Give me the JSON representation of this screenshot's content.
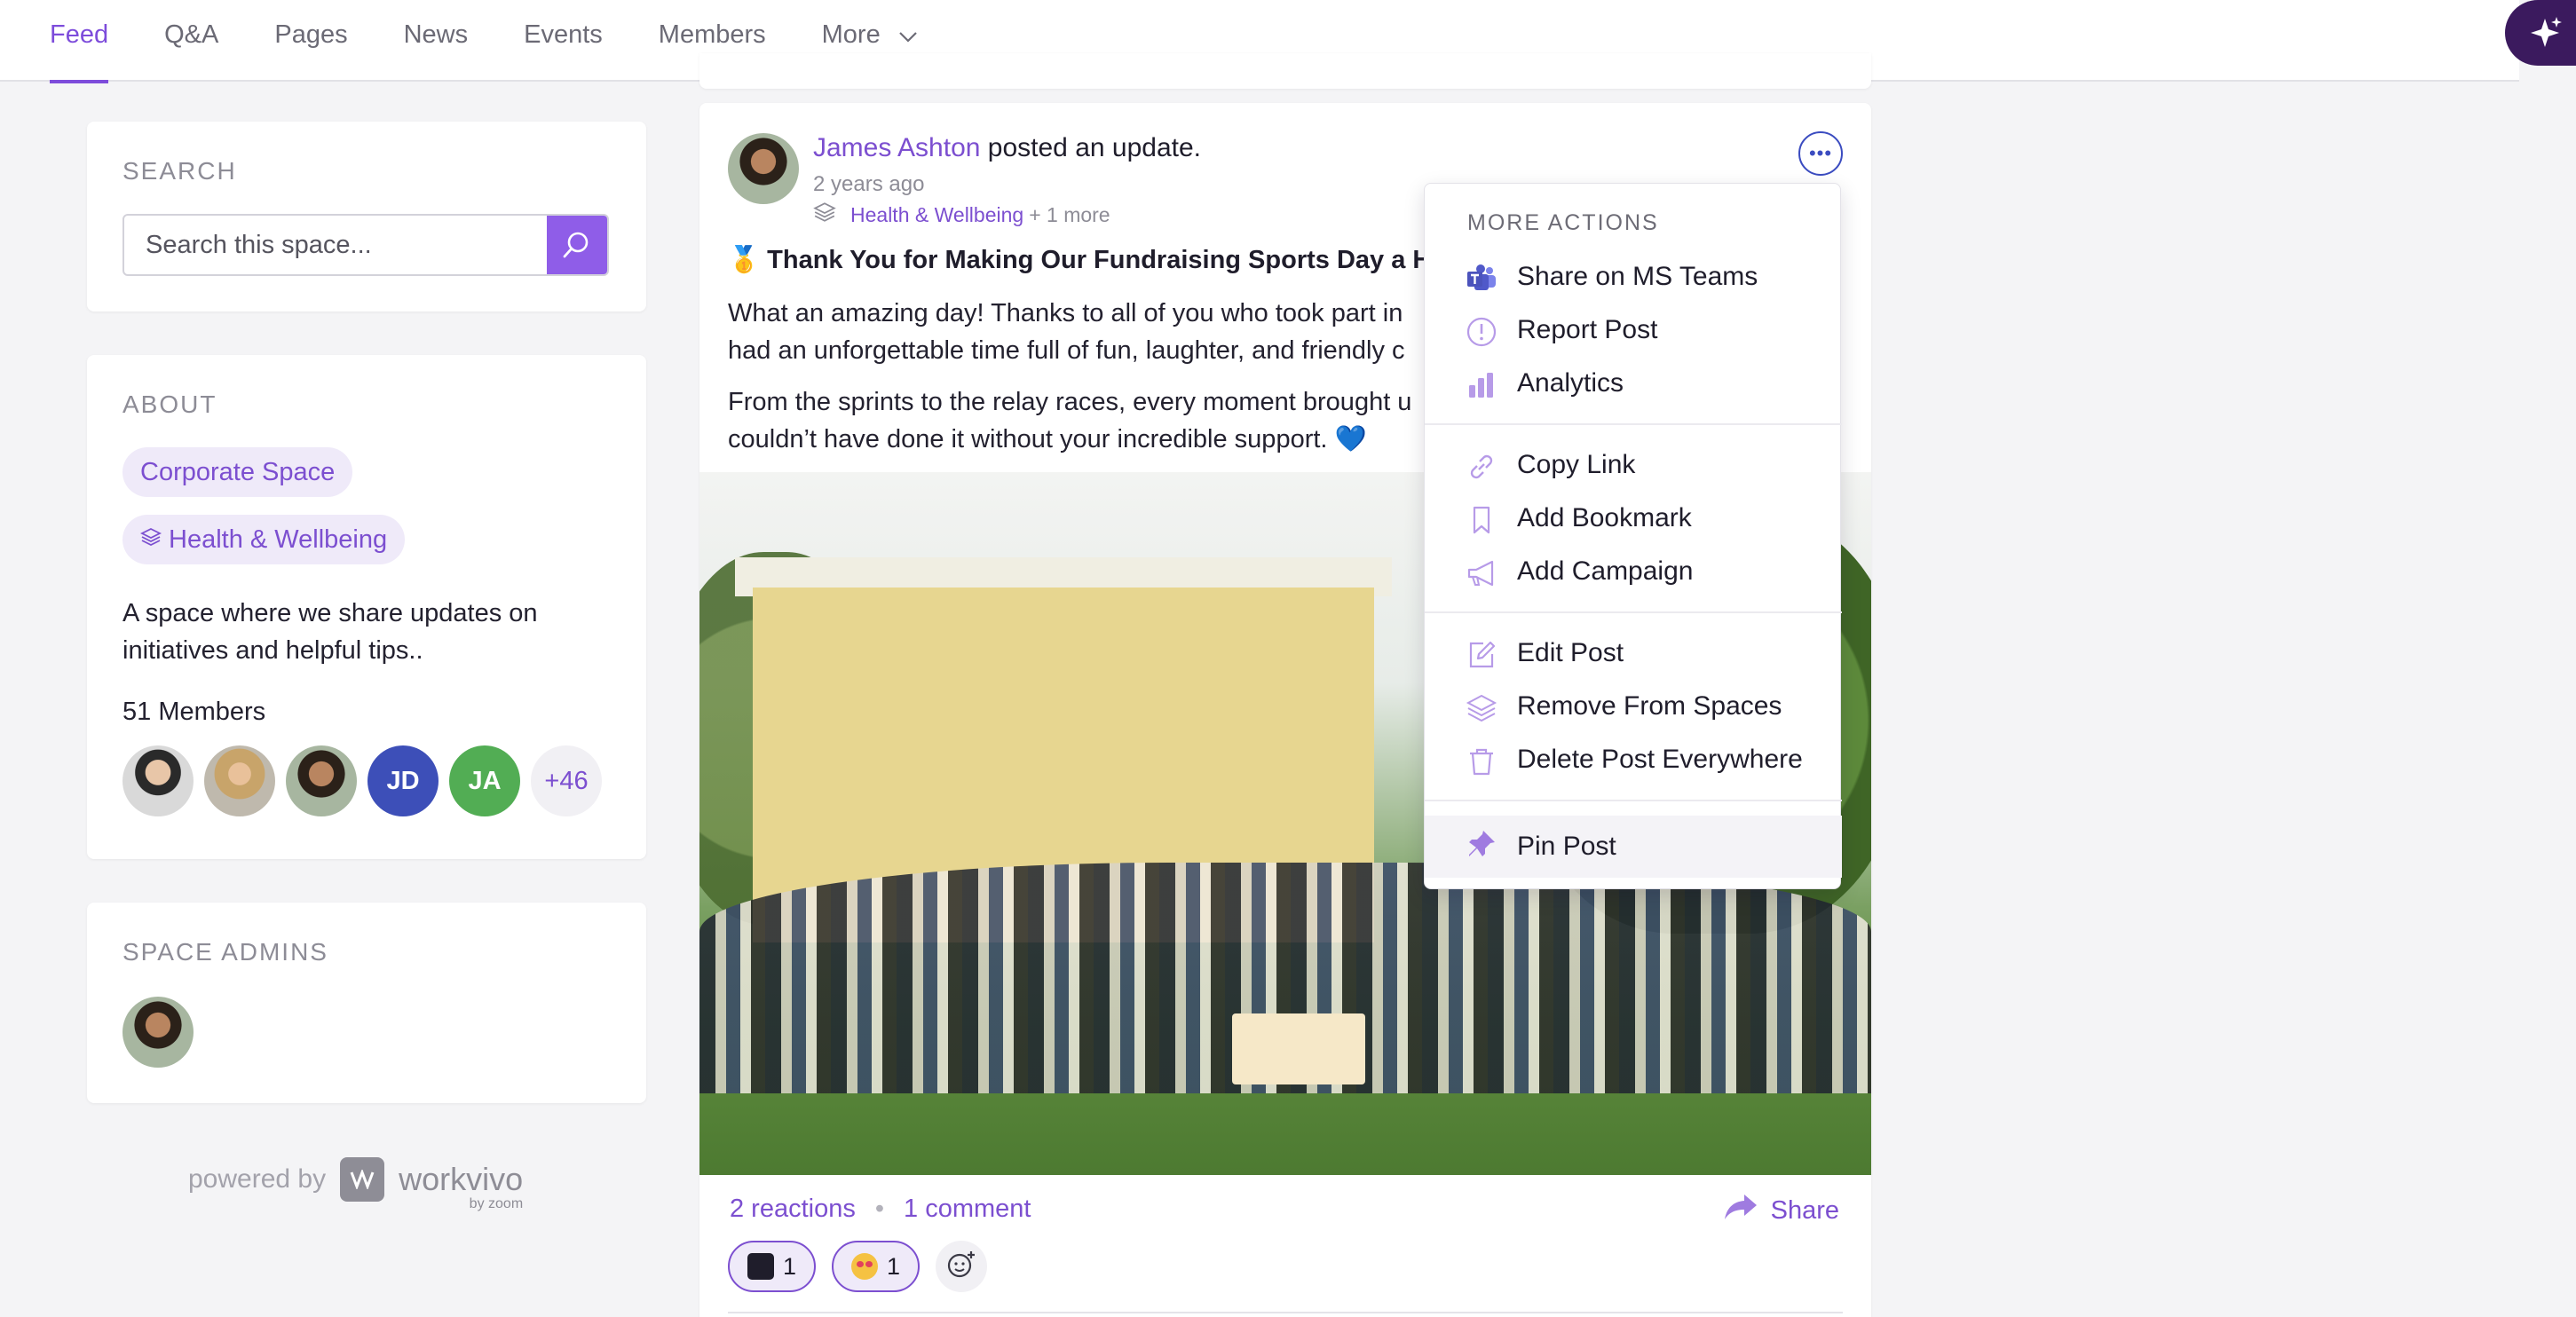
{
  "nav": {
    "tabs": [
      {
        "label": "Feed"
      },
      {
        "label": "Q&A"
      },
      {
        "label": "Pages"
      },
      {
        "label": "News"
      },
      {
        "label": "Events"
      },
      {
        "label": "Members"
      },
      {
        "label": "More"
      }
    ],
    "active_tab": "Feed"
  },
  "search": {
    "label": "SEARCH",
    "placeholder": "Search this space..."
  },
  "about": {
    "label": "ABOUT",
    "tags": [
      "Corporate Space",
      "Health & Wellbeing"
    ],
    "description": "A space where we share updates on initiatives and helpful tips..",
    "members_count": "51 Members",
    "member_initials": [
      "JD",
      "JA"
    ],
    "more_members": "+46"
  },
  "admins": {
    "label": "SPACE ADMINS"
  },
  "powered": {
    "prefix": "powered by",
    "brand": "workvivo",
    "sub": "by zoom"
  },
  "post": {
    "author": "James Ashton",
    "action": "posted an update.",
    "time": "2 years ago",
    "space": "Health & Wellbeing",
    "space_more": "+ 1 more",
    "title": "🥇 Thank You for Making Our Fundraising Sports Day a Hu",
    "body_1": "What an amazing day! Thanks to all of you who took part in",
    "body_1b": "had an unforgettable time full of fun, laughter, and friendly c",
    "body_2": "From the sprints to the relay races, every moment brought u",
    "body_2b": "couldn’t have done it without your incredible support. 💙",
    "reactions": "2 reactions",
    "comments": "1 comment",
    "share": "Share",
    "chip1_count": "1",
    "chip2_count": "1"
  },
  "menu": {
    "heading": "MORE ACTIONS",
    "items": [
      {
        "label": "Share on MS Teams",
        "icon": "ms-teams-icon"
      },
      {
        "label": "Report Post",
        "icon": "report-icon"
      },
      {
        "label": "Analytics",
        "icon": "analytics-icon"
      },
      {
        "label": "Copy Link",
        "icon": "link-icon"
      },
      {
        "label": "Add Bookmark",
        "icon": "bookmark-icon"
      },
      {
        "label": "Add Campaign",
        "icon": "megaphone-icon"
      },
      {
        "label": "Edit Post",
        "icon": "edit-icon"
      },
      {
        "label": "Remove From Spaces",
        "icon": "layers-icon"
      },
      {
        "label": "Delete Post Everywhere",
        "icon": "trash-icon"
      },
      {
        "label": "Pin Post",
        "icon": "pin-icon"
      }
    ]
  },
  "colors": {
    "accent": "#7c4fd0",
    "search_button": "#8f5de8",
    "ai_button": "#3b1a5e"
  }
}
